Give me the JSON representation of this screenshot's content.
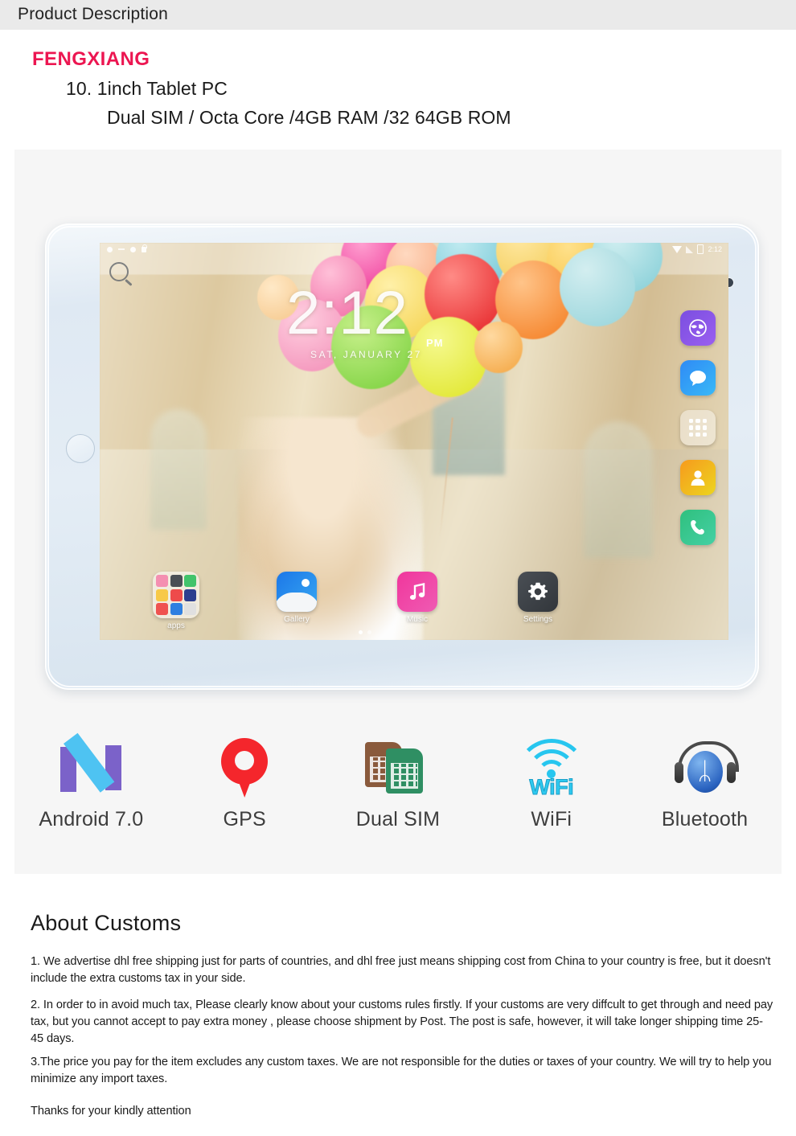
{
  "header": {
    "bar_title": "Product Description"
  },
  "title_block": {
    "brand": "FENGXIANG",
    "model": "10. 1inch Tablet PC",
    "specs": "Dual SIM / Octa Core /4GB RAM /32 64GB ROM",
    "brand_color": "#ec1651"
  },
  "device": {
    "screen": {
      "clock_time": "2:12",
      "clock_meridiem": "PM",
      "clock_date": "SAT, JANUARY 27",
      "status_bar": {
        "time": "2:12",
        "icons": [
          "wifi-icon",
          "signal-icon",
          "battery-icon"
        ]
      },
      "search_icon": "search-icon",
      "rail_icons": [
        {
          "name": "browser-icon",
          "glyph": "◔"
        },
        {
          "name": "messages-icon",
          "glyph": "⬬"
        },
        {
          "name": "app-drawer-icon",
          "glyph": ""
        },
        {
          "name": "contacts-icon",
          "glyph": "♟"
        },
        {
          "name": "phone-icon",
          "glyph": "☎"
        }
      ],
      "dock": [
        {
          "label": "apps",
          "icon": "apps-folder-icon"
        },
        {
          "label": "Gallery",
          "icon": "gallery-icon"
        },
        {
          "label": "Music",
          "icon": "music-icon"
        },
        {
          "label": "Settings",
          "icon": "settings-icon"
        }
      ],
      "page_dots": 2
    },
    "home_button": "home-button",
    "front_camera": "front-camera"
  },
  "features": [
    {
      "label": "Android 7.0",
      "icon": "android-nougat-icon"
    },
    {
      "label": "GPS",
      "icon": "map-pin-icon"
    },
    {
      "label": "Dual SIM",
      "icon": "dual-sim-icon"
    },
    {
      "label": "WiFi",
      "icon": "wifi-icon",
      "icon_text": "WiFi"
    },
    {
      "label": "Bluetooth",
      "icon": "bluetooth-headset-icon",
      "icon_text": "ᛦ"
    }
  ],
  "customs": {
    "heading": "About Customs",
    "p1": "1. We advertise dhl free shipping just for parts of countries, and dhl free just means shipping cost from China to your country is free, but it doesn't include the extra customs tax in your side.",
    "p2": "2. In order to in avoid much tax,  Please clearly know about your customs rules firstly.   If your customs are very diffcult to get through and need pay tax, but you cannot accept to pay extra money , please choose shipment by Post. The post is safe, however, it will take  longer shipping time 25-45 days.",
    "p3": "3.The price you pay for the item excludes any custom taxes. We are not responsible for the duties or taxes of your country. We will try to help you minimize any import taxes.",
    "p4": "Thanks for your kindly attention"
  }
}
